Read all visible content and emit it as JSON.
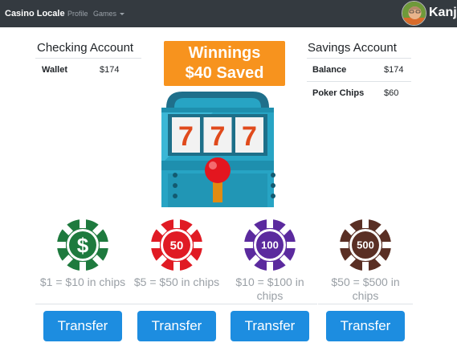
{
  "nav": {
    "brand": "Casino Locale",
    "profile": "Profile",
    "games": "Games",
    "username": "Kanji"
  },
  "checking": {
    "title": "Checking Account",
    "rows": [
      {
        "label": "Wallet",
        "value": "$174"
      }
    ]
  },
  "savings": {
    "title": "Savings Account",
    "rows": [
      {
        "label": "Balance",
        "value": "$174"
      },
      {
        "label": "Poker Chips",
        "value": "$60"
      }
    ]
  },
  "winnings": {
    "line1": "Winnings",
    "line2": "$40 Saved"
  },
  "slot_reels": [
    "7",
    "7",
    "7"
  ],
  "chips": [
    {
      "symbol": "$",
      "caption": "$1 = $10 in chips",
      "button": "Transfer",
      "color": "#1e7a3e"
    },
    {
      "symbol": "50",
      "caption": "$5 = $50 in chips",
      "button": "Transfer",
      "color": "#e01b24"
    },
    {
      "symbol": "100",
      "caption": "$10 = $100 in chips",
      "button": "Transfer",
      "color": "#5b2a9e"
    },
    {
      "symbol": "500",
      "caption": "$50 = $500 in chips",
      "button": "Transfer",
      "color": "#5a2f24"
    }
  ],
  "colors": {
    "navbar": "#343a40",
    "winnings_bg": "#f7931e",
    "button": "#1d8de0",
    "machine_teal": "#27a4c4"
  }
}
